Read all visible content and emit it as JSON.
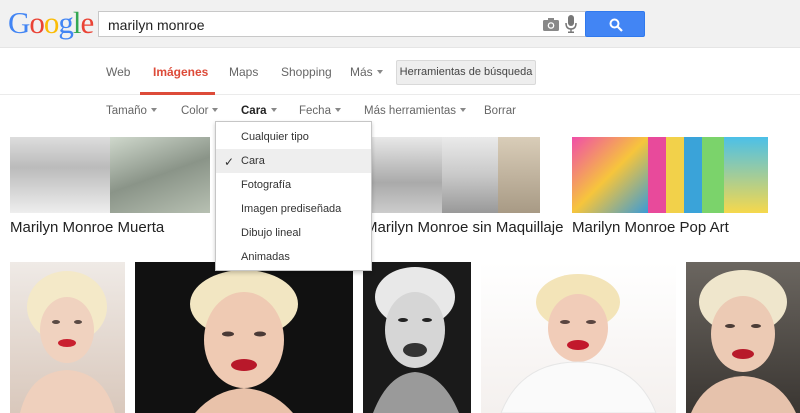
{
  "logo": {
    "text": "Google"
  },
  "search": {
    "query": "marilyn monroe"
  },
  "tabs": [
    {
      "label": "Web"
    },
    {
      "label": "Imágenes"
    },
    {
      "label": "Maps"
    },
    {
      "label": "Shopping"
    },
    {
      "label": "Más"
    }
  ],
  "tools_button": "Herramientas de búsqueda",
  "filters": [
    {
      "label": "Tamaño"
    },
    {
      "label": "Color"
    },
    {
      "label": "Cara"
    },
    {
      "label": "Fecha"
    },
    {
      "label": "Más herramientas"
    },
    {
      "label": "Borrar"
    }
  ],
  "dropdown": {
    "items": [
      {
        "label": "Cualquier tipo"
      },
      {
        "label": "Cara"
      },
      {
        "label": "Fotografía"
      },
      {
        "label": "Imagen prediseñada"
      },
      {
        "label": "Dibujo lineal"
      },
      {
        "label": "Animadas"
      }
    ],
    "selected": "Cara"
  },
  "related": [
    {
      "label": "Marilyn Monroe Muerta"
    },
    {
      "label": "Marilyn Monroe sin Maquillaje"
    },
    {
      "label": "Marilyn Monroe Pop Art"
    }
  ],
  "colors": {
    "google_blue": "#4285f4",
    "google_red": "#ea4335",
    "google_yellow": "#fbbc05",
    "google_green": "#34a853",
    "active_tab": "#dd4b39"
  }
}
